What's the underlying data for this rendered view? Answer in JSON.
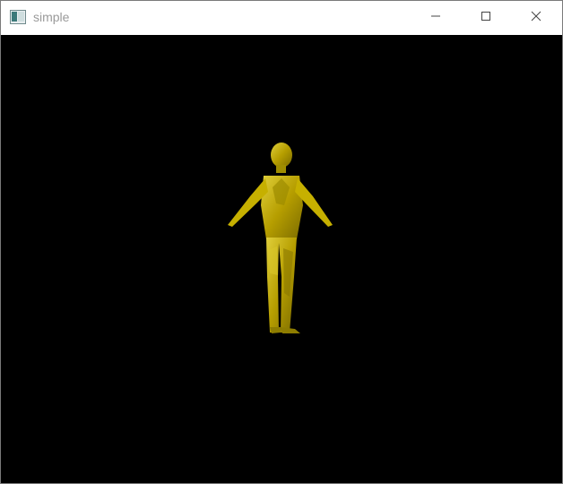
{
  "window": {
    "title": "simple",
    "controls": {
      "minimize_icon": "minimize-icon",
      "maximize_icon": "maximize-icon",
      "close_icon": "close-icon"
    }
  },
  "viewport": {
    "background_color": "#000000",
    "model_color": "#b8a000"
  }
}
